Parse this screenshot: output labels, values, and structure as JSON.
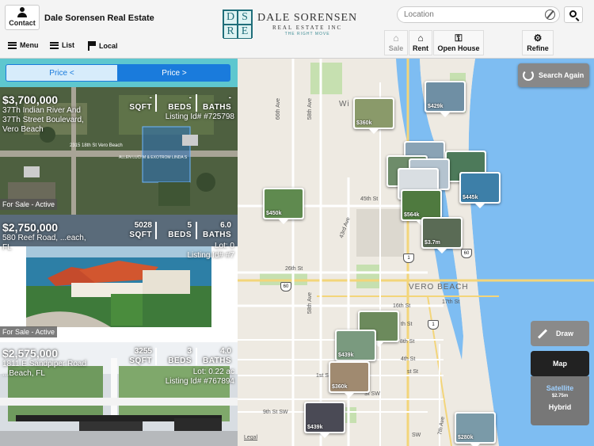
{
  "header": {
    "contact_label": "Contact",
    "brand_name": "Dale Sorensen Real Estate",
    "logo_letters": [
      "D",
      "S",
      "R",
      "E"
    ],
    "logo_line1": "DALE SORENSEN",
    "logo_line2": "REAL ESTATE INC",
    "logo_tagline": "THE RIGHT MOVE",
    "location_placeholder": "Location",
    "menu_label": "Menu",
    "list_label": "List",
    "local_label": "Local",
    "sale_label": "Sale",
    "rent_label": "Rent",
    "open_house_label": "Open House",
    "refine_label": "Refine"
  },
  "sort": {
    "price_asc": "Price <",
    "price_desc": "Price >"
  },
  "listings": [
    {
      "price": "$3,700,000",
      "address": "37Th Indian River And 37Th Street Boulevard, Vero Beach",
      "sqft": "-",
      "sqft_label": "SQFT",
      "beds": "-",
      "beds_label": "BEDS",
      "baths": "-",
      "baths_label": "BATHS",
      "lot": "",
      "listing_id": "Listing Id# #725798",
      "status": "For Sale - Active",
      "photo_caption": "2315 18th St Vero Beach",
      "photo_caption2": "ALLEN LUCI M & EXOTROM LINDA S"
    },
    {
      "price": "$2,750,000",
      "address": "580 Reef Road, ...each, FL",
      "sqft": "5028",
      "sqft_label": "SQFT",
      "beds": "5",
      "beds_label": "BEDS",
      "baths": "6.0",
      "baths_label": "BATHS",
      "lot": "Lot: 0",
      "listing_id": "Listing Id# #7",
      "status": "For Sale - Active"
    },
    {
      "price": "$2,575,000",
      "address": "1811 E Sandpiper Road ...Beach, FL",
      "sqft": "3255",
      "sqft_label": "SQFT",
      "beds": "3",
      "beds_label": "BEDS",
      "baths": "4.0",
      "baths_label": "BATHS",
      "lot": "Lot: 0.22 ac",
      "listing_id": "Listing Id# #767894",
      "status": ""
    }
  ],
  "map": {
    "search_again_label": "Search Again",
    "draw_label": "Draw",
    "map_label": "Map",
    "satellite_label": "Satellite",
    "hybrid_label": "Hybrid",
    "satellite_thumb_price": "$2.75m",
    "legal_label": "Legal",
    "city_label": "VERO BEACH",
    "town_partial": "Wi",
    "streets": {
      "s66": "66th Ave",
      "s58": "58th Ave",
      "s43": "43rd Ave",
      "s58b": "58th Ave",
      "s45": "45th St",
      "s26": "26th St",
      "s17": "17th St",
      "s16": "16th St",
      "s8": "8th St",
      "s4": "4th St",
      "s1": "1st St",
      "s9sw": "9th St SW",
      "s7": "7th Ave",
      "sth": "th St",
      "st": "st St",
      "stsw": "St SW",
      "sw": "SW",
      "s60": "60",
      "s1r": "1",
      "s60b": "60",
      "s1b": "1"
    },
    "pins": [
      {
        "price": "$429k"
      },
      {
        "price": "$360k"
      },
      {
        "price": "$450k"
      },
      {
        "price": "$445k"
      },
      {
        "price": "$564k"
      },
      {
        "price": "$3.7m"
      },
      {
        "price": "$360k"
      },
      {
        "price": "$439k"
      },
      {
        "price": "$439k"
      },
      {
        "price": "$280k"
      }
    ]
  }
}
